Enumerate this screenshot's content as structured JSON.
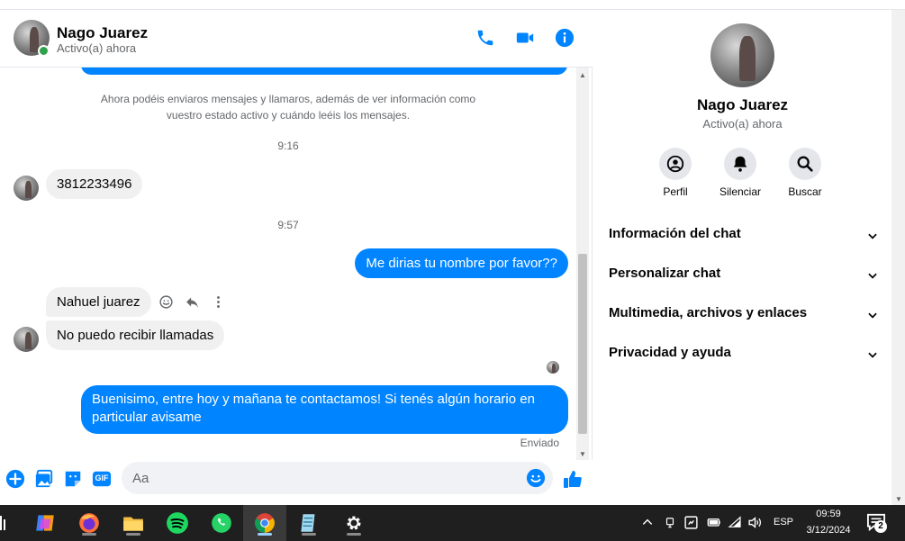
{
  "contact": {
    "name": "Nago Juarez",
    "status": "Activo(a) ahora"
  },
  "messages": {
    "system_notice": "Ahora podéis enviaros mensajes y llamaros, además de ver información como vuestro estado activo y cuándo leéis los mensajes.",
    "time1": "9:16",
    "in1": "3812233496",
    "time2": "9:57",
    "out1": "Me dirias tu nombre por favor??",
    "in2": "Nahuel juarez",
    "in3": "No puedo recibir llamadas",
    "out2": "Buenisimo, entre hoy y mañana te contactamos! Si tenés algún horario en particular avisame",
    "sent_status": "Enviado"
  },
  "composer": {
    "placeholder": "Aa",
    "gif_label": "GIF"
  },
  "info_panel": {
    "actions": [
      "Perfil",
      "Silenciar",
      "Buscar"
    ],
    "sections": [
      "Información del chat",
      "Personalizar chat",
      "Multimedia, archivos y enlaces",
      "Privacidad y ayuda"
    ]
  },
  "taskbar": {
    "language": "ESP",
    "time": "09:59",
    "date": "3/12/2024",
    "notifications": "2"
  },
  "colors": {
    "accent": "#0084ff",
    "online": "#31a24c",
    "incoming_bubble": "#f0f0f0"
  }
}
